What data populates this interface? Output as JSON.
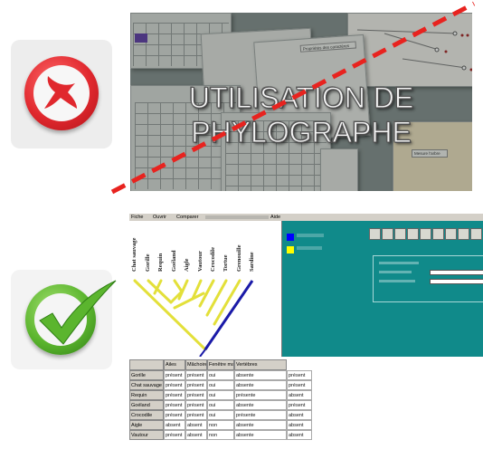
{
  "colors": {
    "wrong_red": "#e0282e",
    "right_green": "#5bb52e",
    "teal": "#108a8a",
    "tree_yellow": "#e3e03a",
    "tree_blue": "#1a1aa8",
    "legend_blue": "#0000ff",
    "legend_yellow": "#ffff00",
    "slash_red": "#e8231f"
  },
  "top_image": {
    "title_line1": "UTILISATION DE",
    "title_line2": "PHYLOGRAPHE"
  },
  "bottom_image": {
    "menu": [
      "Fiche",
      "Ouvrir",
      "Comparer",
      "Aide"
    ],
    "species": [
      "Chat sauvage",
      "Gorille",
      "Requin",
      "Goéland",
      "Aigle",
      "Vautour",
      "Crocodile",
      "Tortue",
      "Grenouille",
      "Sardine"
    ],
    "table_headers": [
      "",
      "Ailes",
      "Mâchoire",
      "Fenêtre mandibulaire",
      "Vertèbres"
    ],
    "rows": [
      {
        "name": "Gorille",
        "cells": [
          "présent",
          "présent",
          "oui",
          "absente",
          "présent"
        ]
      },
      {
        "name": "Chat sauvage",
        "cells": [
          "présent",
          "présent",
          "oui",
          "absente",
          "présent"
        ]
      },
      {
        "name": "Requin",
        "cells": [
          "présent",
          "présent",
          "oui",
          "présente",
          "absent"
        ]
      },
      {
        "name": "Goéland",
        "cells": [
          "présent",
          "présent",
          "oui",
          "absente",
          "présent"
        ]
      },
      {
        "name": "Crocodile",
        "cells": [
          "présent",
          "présent",
          "oui",
          "présente",
          "absent"
        ]
      },
      {
        "name": "Aigle",
        "cells": [
          "absent",
          "absent",
          "non",
          "absente",
          "absent"
        ]
      },
      {
        "name": "Vautour",
        "cells": [
          "présent",
          "absent",
          "non",
          "absente",
          "absent"
        ]
      }
    ]
  }
}
